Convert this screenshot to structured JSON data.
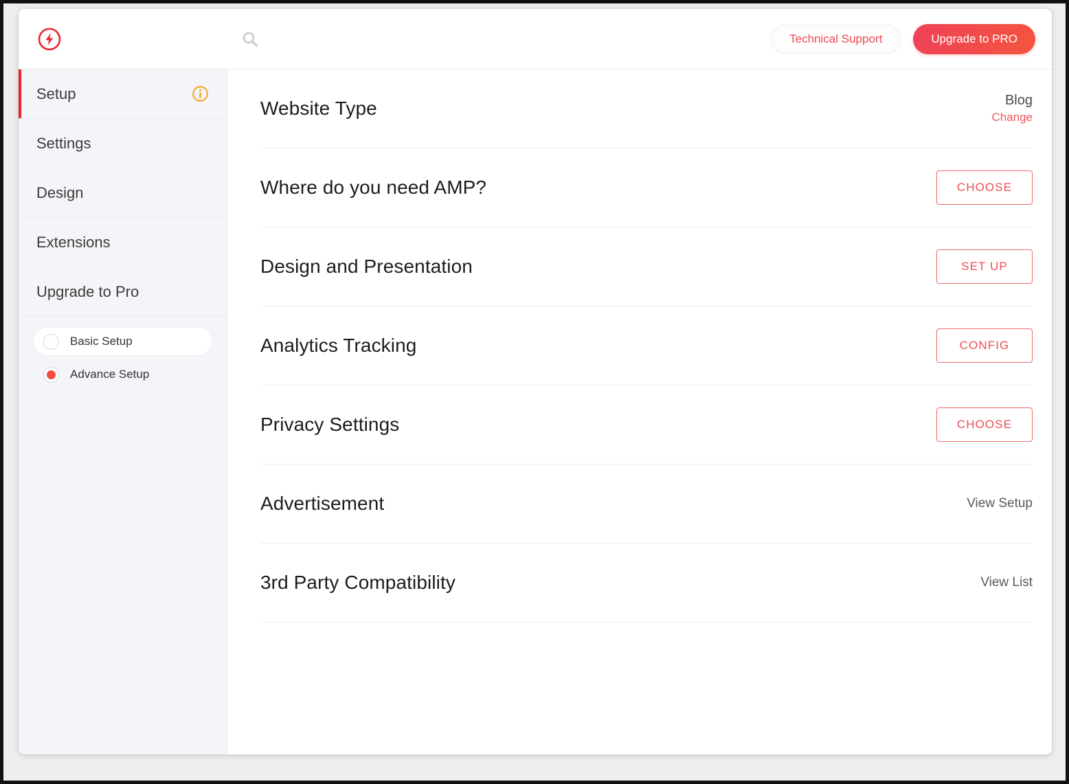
{
  "header": {
    "logo_icon": "amp-bolt-logo",
    "search_icon": "search-icon",
    "support_label": "Technical Support",
    "pro_label": "Upgrade to PRO"
  },
  "sidebar": {
    "items": [
      {
        "label": "Setup",
        "active": true,
        "icon": "info-icon"
      },
      {
        "label": "Settings",
        "active": false
      },
      {
        "label": "Design",
        "active": false
      },
      {
        "label": "Extensions",
        "active": false
      },
      {
        "label": "Upgrade to Pro",
        "active": false
      }
    ],
    "modes": [
      {
        "label": "Basic Setup",
        "selected": false
      },
      {
        "label": "Advance Setup",
        "selected": true
      }
    ]
  },
  "main": {
    "rows": [
      {
        "title": "Website Type",
        "action_type": "value",
        "value": "Blog",
        "change_label": "Change"
      },
      {
        "title": "Where do you need AMP?",
        "action_type": "button",
        "button_label": "CHOOSE"
      },
      {
        "title": "Design and Presentation",
        "action_type": "button",
        "button_label": "SET UP"
      },
      {
        "title": "Analytics Tracking",
        "action_type": "button",
        "button_label": "CONFIG"
      },
      {
        "title": "Privacy Settings",
        "action_type": "button",
        "button_label": "CHOOSE"
      },
      {
        "title": "Advertisement",
        "action_type": "link",
        "link_label": "View Setup"
      },
      {
        "title": "3rd Party Compatibility",
        "action_type": "link",
        "link_label": "View List"
      }
    ]
  },
  "colors": {
    "brand_red": "#e8262d",
    "accent_red": "#f04a53",
    "pro_gradient_start": "#ef4158",
    "pro_gradient_end": "#f4553e",
    "info_orange": "#f5a623",
    "sidebar_bg": "#f4f5f8"
  }
}
